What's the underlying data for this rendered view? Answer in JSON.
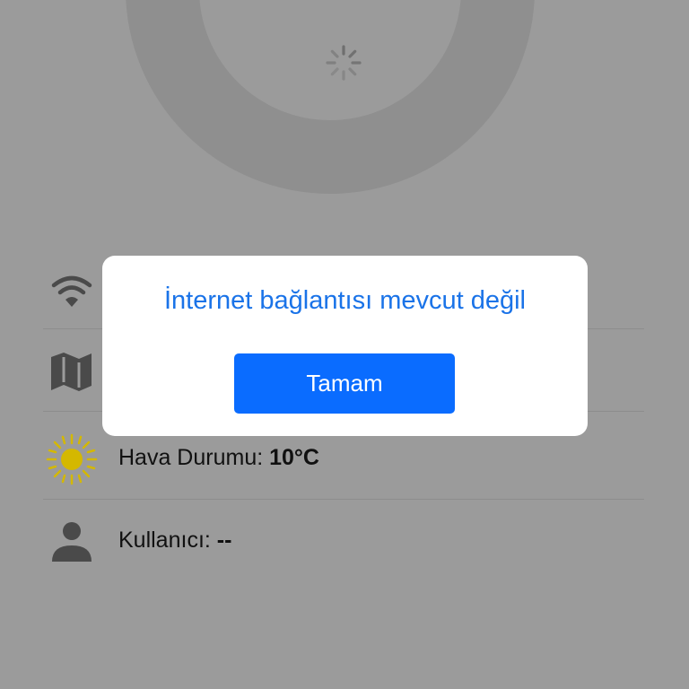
{
  "status_list": {
    "weather": {
      "label": "Hava Durumu:",
      "value": "10°C"
    },
    "user": {
      "label": "Kullanıcı:",
      "value": "--"
    }
  },
  "dialog": {
    "message": "İnternet bağlantısı mevcut değil",
    "button_label": "Tamam"
  },
  "colors": {
    "overlay_bg": "#9b9b9b",
    "accent": "#0a6cff",
    "message_text": "#1a73e8",
    "sun": "#d4b800"
  }
}
